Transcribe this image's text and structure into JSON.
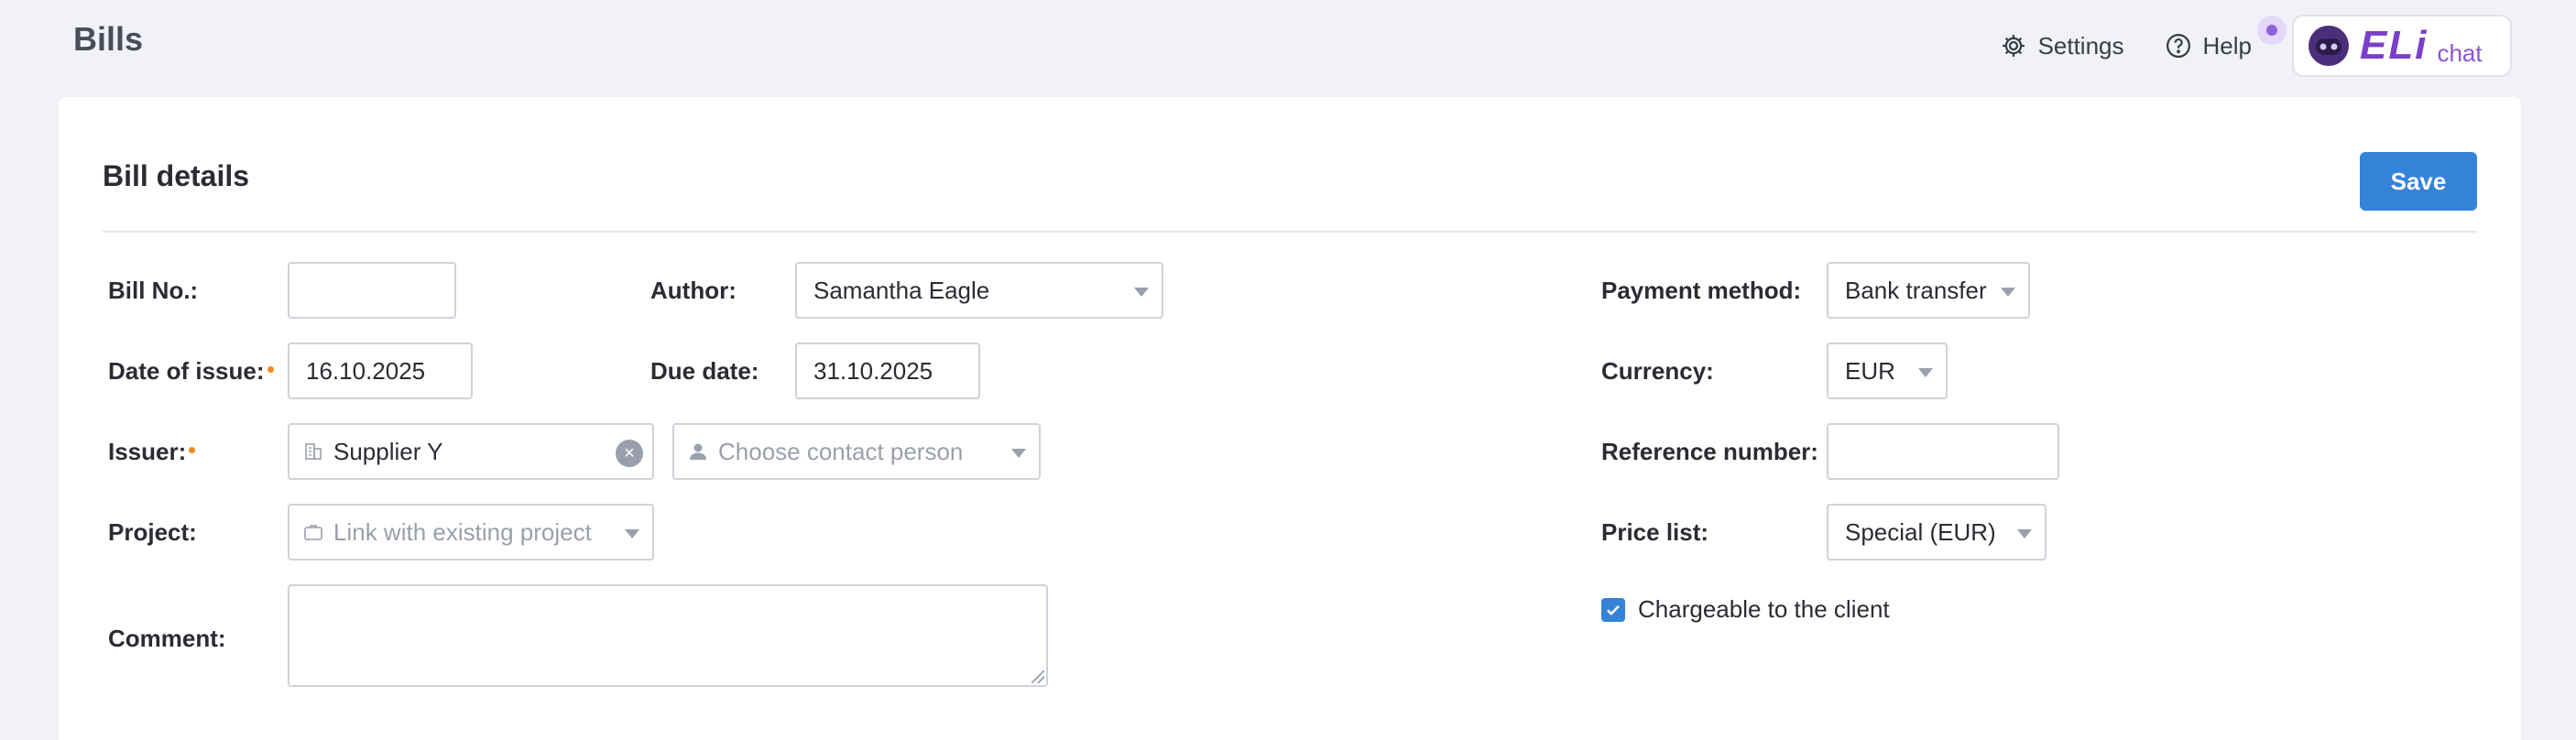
{
  "page": {
    "title": "Bills"
  },
  "topbar": {
    "settings_label": "Settings",
    "help_label": "Help",
    "eli_logo": "ELi",
    "eli_chat": "chat"
  },
  "card": {
    "title": "Bill details",
    "save_label": "Save"
  },
  "form": {
    "bill_no": {
      "label": "Bill No.:",
      "value": ""
    },
    "author": {
      "label": "Author:",
      "value": "Samantha Eagle"
    },
    "date_of_issue": {
      "label": "Date of issue:",
      "value": "16.10.2025"
    },
    "due_date": {
      "label": "Due date:",
      "value": "31.10.2025"
    },
    "issuer": {
      "label": "Issuer:",
      "value": "Supplier Y",
      "contact_placeholder": "Choose contact person"
    },
    "project": {
      "label": "Project:",
      "placeholder": "Link with existing project"
    },
    "comment": {
      "label": "Comment:",
      "value": ""
    },
    "payment_method": {
      "label": "Payment method:",
      "value": "Bank transfer"
    },
    "currency": {
      "label": "Currency:",
      "value": "EUR"
    },
    "reference_number": {
      "label": "Reference number:",
      "value": ""
    },
    "price_list": {
      "label": "Price list:",
      "value": "Special (EUR)"
    },
    "chargeable": {
      "label": "Chargeable to the client",
      "checked": true
    }
  },
  "colors": {
    "accent": "#3583d9",
    "required_dot": "#f08a24",
    "eli_purple": "#7a3fc8"
  }
}
